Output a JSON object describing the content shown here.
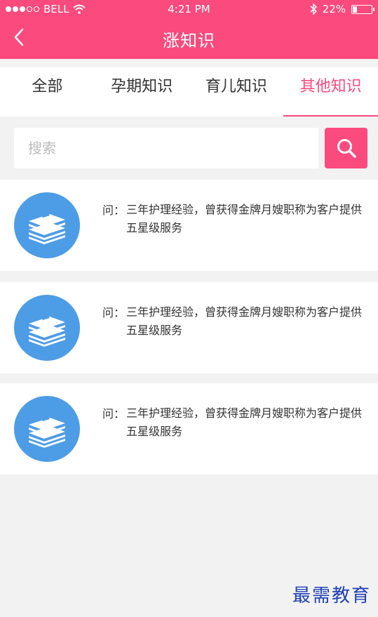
{
  "status_bar": {
    "carrier": "BELL",
    "time": "4:21 PM",
    "battery": "22%",
    "battery_level": 0.22,
    "icons": [
      "signal-dots-icon",
      "wifi-icon",
      "bluetooth-icon",
      "battery-icon"
    ]
  },
  "nav": {
    "title": "涨知识",
    "back_icon": "chevron-left-icon"
  },
  "tabs": [
    {
      "label": "全部",
      "active": false
    },
    {
      "label": "孕期知识",
      "active": false
    },
    {
      "label": "育儿知识",
      "active": false
    },
    {
      "label": "其他知识",
      "active": true
    }
  ],
  "search": {
    "placeholder": "搜索",
    "value": "",
    "icon": "search-icon"
  },
  "list": [
    {
      "q_label": "问：",
      "text": "三年护理经验，曾获得金牌月嫂职称为客户提供五星级服务",
      "icon": "book-stack-icon"
    },
    {
      "q_label": "问：",
      "text": "三年护理经验，曾获得金牌月嫂职称为客户提供五星级服务",
      "icon": "book-stack-icon"
    },
    {
      "q_label": "问：",
      "text": "三年护理经验，曾获得金牌月嫂职称为客户提供五星级服务",
      "icon": "book-stack-icon"
    }
  ],
  "watermark": "最需教育",
  "colors": {
    "brand": "#fb4a7d",
    "avatar": "#4d9ce6",
    "background": "#f2f2f2"
  }
}
